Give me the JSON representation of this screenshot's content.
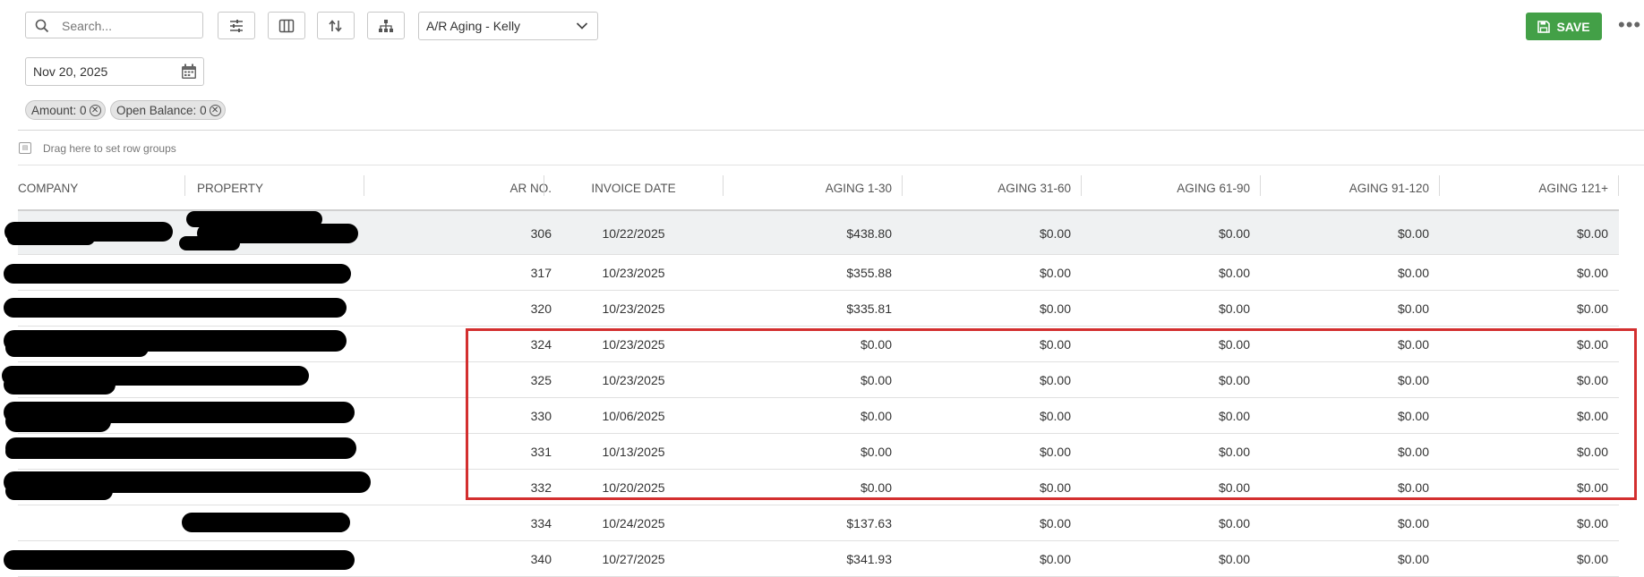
{
  "toolbar": {
    "search_placeholder": "Search...",
    "filter_icon": "sliders-icon",
    "columns_icon": "columns-icon",
    "sort_icon": "sort-arrows-icon",
    "hierarchy_icon": "hierarchy-icon",
    "report_select": "A/R Aging - Kelly",
    "save_label": "SAVE",
    "more_label": "•••"
  },
  "date_filter": {
    "value": "Nov 20, 2025",
    "icon": "calendar-icon"
  },
  "filter_chips": [
    {
      "label": "Amount: 0"
    },
    {
      "label": "Open Balance: 0"
    }
  ],
  "row_groups_hint": "Drag here to set row groups",
  "columns": [
    "COMPANY",
    "PROPERTY",
    "AR NO.",
    "INVOICE DATE",
    "AGING 1-30",
    "AGING 31-60",
    "AGING 61-90",
    "AGING 91-120",
    "AGING 121+"
  ],
  "rows": [
    {
      "ar_no": "306",
      "invoice_date": "10/22/2025",
      "a1": "$438.80",
      "a2": "$0.00",
      "a3": "$0.00",
      "a4": "$0.00",
      "a5": "$0.00"
    },
    {
      "ar_no": "317",
      "invoice_date": "10/23/2025",
      "a1": "$355.88",
      "a2": "$0.00",
      "a3": "$0.00",
      "a4": "$0.00",
      "a5": "$0.00"
    },
    {
      "ar_no": "320",
      "invoice_date": "10/23/2025",
      "a1": "$335.81",
      "a2": "$0.00",
      "a3": "$0.00",
      "a4": "$0.00",
      "a5": "$0.00"
    },
    {
      "ar_no": "324",
      "invoice_date": "10/23/2025",
      "a1": "$0.00",
      "a2": "$0.00",
      "a3": "$0.00",
      "a4": "$0.00",
      "a5": "$0.00"
    },
    {
      "ar_no": "325",
      "invoice_date": "10/23/2025",
      "a1": "$0.00",
      "a2": "$0.00",
      "a3": "$0.00",
      "a4": "$0.00",
      "a5": "$0.00"
    },
    {
      "ar_no": "330",
      "invoice_date": "10/06/2025",
      "a1": "$0.00",
      "a2": "$0.00",
      "a3": "$0.00",
      "a4": "$0.00",
      "a5": "$0.00"
    },
    {
      "ar_no": "331",
      "invoice_date": "10/13/2025",
      "a1": "$0.00",
      "a2": "$0.00",
      "a3": "$0.00",
      "a4": "$0.00",
      "a5": "$0.00"
    },
    {
      "ar_no": "332",
      "invoice_date": "10/20/2025",
      "a1": "$0.00",
      "a2": "$0.00",
      "a3": "$0.00",
      "a4": "$0.00",
      "a5": "$0.00"
    },
    {
      "ar_no": "334",
      "invoice_date": "10/24/2025",
      "a1": "$137.63",
      "a2": "$0.00",
      "a3": "$0.00",
      "a4": "$0.00",
      "a5": "$0.00"
    },
    {
      "ar_no": "340",
      "invoice_date": "10/27/2025",
      "a1": "$341.93",
      "a2": "$0.00",
      "a3": "$0.00",
      "a4": "$0.00",
      "a5": "$0.00"
    }
  ],
  "colors": {
    "save": "#43a047",
    "highlight": "#d32f2f",
    "selected_row": "#eff1f2"
  }
}
